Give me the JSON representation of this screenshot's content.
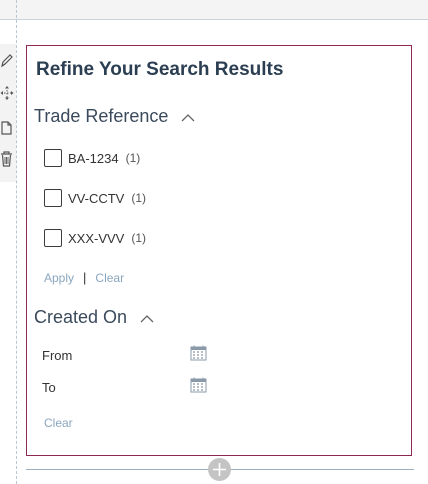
{
  "colors": {
    "panel_border": "#8c2a54",
    "title": "#2c3e52",
    "link": "#8aa6bf",
    "checkbox_border": "#3d3d3d"
  },
  "toolbar": {
    "icons": [
      "pencil-icon",
      "move-icon",
      "copy-icon",
      "trash-icon"
    ]
  },
  "panel": {
    "title": "Refine Your Search Results",
    "trade_reference": {
      "header": "Trade Reference",
      "expanded": true,
      "options": [
        {
          "label": "BA-1234",
          "count": "(1)",
          "checked": false
        },
        {
          "label": "VV-CCTV",
          "count": "(1)",
          "checked": false
        },
        {
          "label": "XXX-VVV",
          "count": "(1)",
          "checked": false
        }
      ],
      "apply_label": "Apply",
      "separator": "|",
      "clear_label": "Clear"
    },
    "created_on": {
      "header": "Created On",
      "expanded": true,
      "from_label": "From",
      "to_label": "To",
      "clear_label": "Clear"
    }
  },
  "add_button_icon": "plus-icon"
}
